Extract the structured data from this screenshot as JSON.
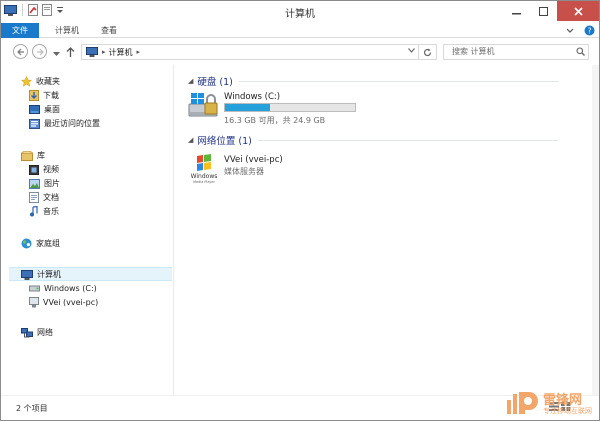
{
  "window": {
    "title": "计算机"
  },
  "ribbon": {
    "tabs": [
      {
        "label": "文件"
      },
      {
        "label": "计算机"
      },
      {
        "label": "查看"
      }
    ]
  },
  "address": {
    "crumbs": [
      {
        "label": "计算机"
      }
    ],
    "search_placeholder": "搜索 计算机"
  },
  "nav": {
    "favorites": {
      "label": "收藏夹",
      "items": [
        {
          "label": "下载"
        },
        {
          "label": "桌面"
        },
        {
          "label": "最近访问的位置"
        }
      ]
    },
    "libraries": {
      "label": "库",
      "items": [
        {
          "label": "视频"
        },
        {
          "label": "图片"
        },
        {
          "label": "文档"
        },
        {
          "label": "音乐"
        }
      ]
    },
    "homegroup": {
      "label": "家庭组"
    },
    "computer": {
      "label": "计算机",
      "items": [
        {
          "label": "Windows (C:)"
        },
        {
          "label": "VVei (vvei-pc)"
        }
      ]
    },
    "network": {
      "label": "网络"
    }
  },
  "content": {
    "groups": [
      {
        "label": "硬盘 (1)"
      },
      {
        "label": "网络位置 (1)"
      }
    ],
    "drive": {
      "name": "Windows (C:)",
      "info": "16.3 GB 可用，共 24.9 GB",
      "used_fraction": 0.345
    },
    "media_server": {
      "name": "VVei (vvei-pc)",
      "sub": "媒体服务器",
      "logo_text": "Windows",
      "logo_sub": "Media Player"
    }
  },
  "status": {
    "count": "2 个项目"
  },
  "watermark": {
    "title": "雷锋网",
    "sub": "专注移动互联网"
  },
  "colors": {
    "accent": "#1979ca",
    "close": "#c7504a",
    "selection": "#e5f3fb",
    "drive_fill": "#26a0da",
    "group_text": "#1e3287"
  }
}
